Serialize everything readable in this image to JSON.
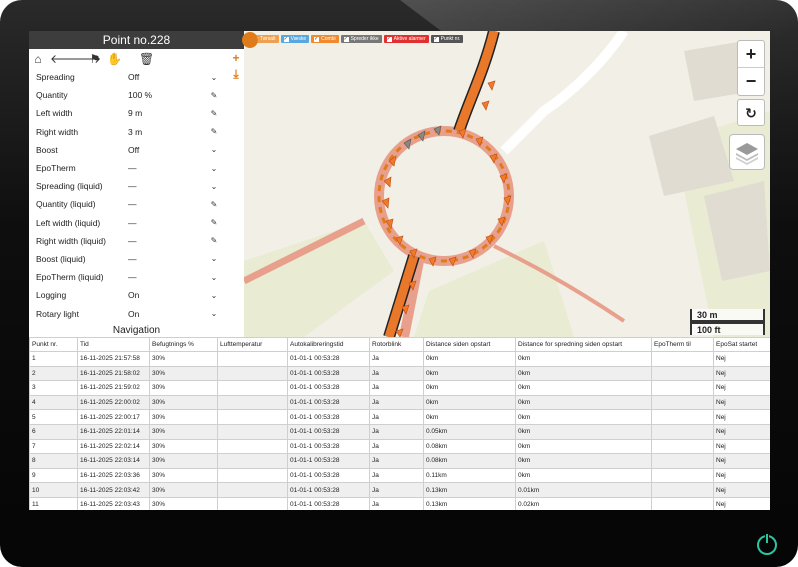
{
  "panel": {
    "title": "Point no.228",
    "rows": [
      {
        "label": "Spreading",
        "value": "Off",
        "control": "chevron"
      },
      {
        "label": "Quantity",
        "value": "100 %",
        "control": "pencil"
      },
      {
        "label": "Left width",
        "value": "9 m",
        "control": "pencil"
      },
      {
        "label": "Right width",
        "value": "3 m",
        "control": "pencil"
      },
      {
        "label": "Boost",
        "value": "Off",
        "control": "chevron"
      },
      {
        "label": "EpoTherm",
        "value": "—",
        "control": "chevron"
      },
      {
        "label": "Spreading (liquid)",
        "value": "—",
        "control": "chevron"
      },
      {
        "label": "Quantity (liquid)",
        "value": "—",
        "control": "pencil"
      },
      {
        "label": "Left width (liquid)",
        "value": "—",
        "control": "pencil"
      },
      {
        "label": "Right width (liquid)",
        "value": "—",
        "control": "pencil"
      },
      {
        "label": "Boost (liquid)",
        "value": "—",
        "control": "chevron"
      },
      {
        "label": "EpoTherm (liquid)",
        "value": "—",
        "control": "chevron"
      },
      {
        "label": "Logging",
        "value": "On",
        "control": "chevron"
      },
      {
        "label": "Rotary light",
        "value": "On",
        "control": "chevron"
      }
    ],
    "navigation_label": "Navigation"
  },
  "map": {
    "chips": [
      {
        "label": "Tørsalt",
        "color": "#f0a050"
      },
      {
        "label": "Væske",
        "color": "#5aa7e0"
      },
      {
        "label": "Combi",
        "color": "#f08a30"
      },
      {
        "label": "Spreder ikke",
        "color": "#777777"
      },
      {
        "label": "Aktive alarmer",
        "color": "#e03030"
      },
      {
        "label": "Punkt nr.",
        "color": "#555555"
      }
    ],
    "zoom_in": "+",
    "zoom_out": "−",
    "refresh": "↻",
    "scale_metric": "30 m",
    "scale_imperial": "100 ft"
  },
  "table": {
    "headers": [
      "Punkt nr.",
      "Tid",
      "Befugtnings %",
      "Lufttemperatur",
      "Autokalibreringstid",
      "Rotorblink",
      "Distance siden opstart",
      "Distance for spredning siden opstart",
      "EpoTherm til",
      "EpoSat startet"
    ],
    "rows": [
      [
        "1",
        "16-11-2025 21:57:58",
        "30%",
        "",
        "01-01-1 00:53:28",
        "Ja",
        "0km",
        "0km",
        "",
        "Nej"
      ],
      [
        "2",
        "16-11-2025 21:58:02",
        "30%",
        "",
        "01-01-1 00:53:28",
        "Ja",
        "0km",
        "0km",
        "",
        "Nej"
      ],
      [
        "3",
        "16-11-2025 21:59:02",
        "30%",
        "",
        "01-01-1 00:53:28",
        "Ja",
        "0km",
        "0km",
        "",
        "Nej"
      ],
      [
        "4",
        "16-11-2025 22:00:02",
        "30%",
        "",
        "01-01-1 00:53:28",
        "Ja",
        "0km",
        "0km",
        "",
        "Nej"
      ],
      [
        "5",
        "16-11-2025 22:00:17",
        "30%",
        "",
        "01-01-1 00:53:28",
        "Ja",
        "0km",
        "0km",
        "",
        "Nej"
      ],
      [
        "6",
        "16-11-2025 22:01:14",
        "30%",
        "",
        "01-01-1 00:53:28",
        "Ja",
        "0.05km",
        "0km",
        "",
        "Nej"
      ],
      [
        "7",
        "16-11-2025 22:02:14",
        "30%",
        "",
        "01-01-1 00:53:28",
        "Ja",
        "0.08km",
        "0km",
        "",
        "Nej"
      ],
      [
        "8",
        "16-11-2025 22:03:14",
        "30%",
        "",
        "01-01-1 00:53:28",
        "Ja",
        "0.08km",
        "0km",
        "",
        "Nej"
      ],
      [
        "9",
        "16-11-2025 22:03:36",
        "30%",
        "",
        "01-01-1 00:53:28",
        "Ja",
        "0.11km",
        "0km",
        "",
        "Nej"
      ],
      [
        "10",
        "16-11-2025 22:03:42",
        "30%",
        "",
        "01-01-1 00:53:28",
        "Ja",
        "0.13km",
        "0.01km",
        "",
        "Nej"
      ],
      [
        "11",
        "16-11-2025 22:03:43",
        "30%",
        "",
        "01-01-1 00:53:28",
        "Ja",
        "0.13km",
        "0.02km",
        "",
        "Nej"
      ]
    ]
  }
}
